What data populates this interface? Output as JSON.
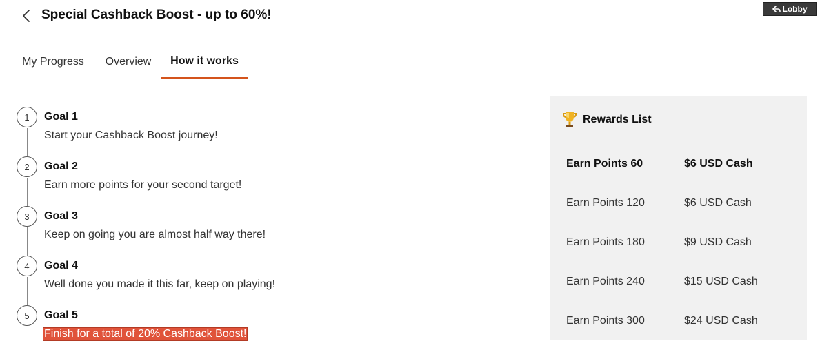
{
  "header": {
    "title": "Special Cashback Boost - up to 60%!",
    "lobby_label": "Lobby"
  },
  "tabs": [
    {
      "label": "My Progress"
    },
    {
      "label": "Overview"
    },
    {
      "label": "How it works",
      "active": true
    }
  ],
  "goals": [
    {
      "number": "1",
      "title": "Goal 1",
      "description": "Start your Cashback Boost journey!"
    },
    {
      "number": "2",
      "title": "Goal 2",
      "description": "Earn more points for your second target!"
    },
    {
      "number": "3",
      "title": "Goal 3",
      "description": "Keep on going you are almost half way there!"
    },
    {
      "number": "4",
      "title": "Goal 4",
      "description": "Well done you made it this far, keep on playing!"
    },
    {
      "number": "5",
      "title": "Goal 5",
      "description": "Finish for a total of 20% Cashback Boost!"
    }
  ],
  "rewards": {
    "title": "Rewards List",
    "icon": "trophy-icon",
    "items": [
      {
        "points": "Earn Points 60",
        "prize": "$6 USD Cash",
        "active": true
      },
      {
        "points": "Earn Points 120",
        "prize": "$6 USD Cash"
      },
      {
        "points": "Earn Points 180",
        "prize": "$9 USD Cash"
      },
      {
        "points": "Earn Points 240",
        "prize": "$15 USD Cash"
      },
      {
        "points": "Earn Points 300",
        "prize": "$24 USD Cash"
      }
    ]
  },
  "colors": {
    "accent": "#d4541c",
    "highlight": "#e0533a",
    "panel_bg": "#f1f1f1",
    "lobby_bg": "#3a3a3a"
  }
}
